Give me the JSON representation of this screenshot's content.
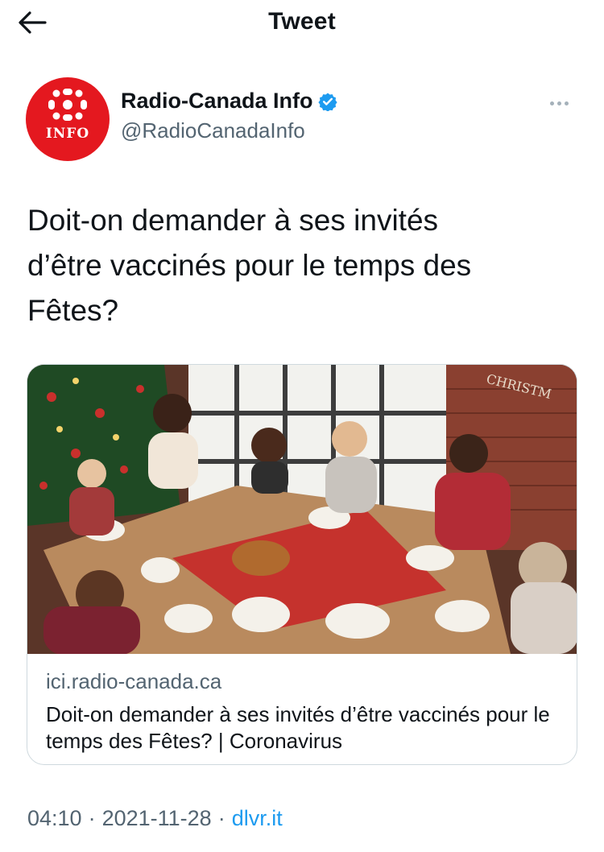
{
  "header": {
    "title": "Tweet",
    "back_icon": "arrow-left-icon"
  },
  "author": {
    "display_name": "Radio-Canada Info",
    "handle": "@RadioCanadaInfo",
    "verified": true,
    "avatar_label": "INFO",
    "brand_color": "#e4181f",
    "verified_color": "#1d9bf0"
  },
  "tweet": {
    "text": "Doit-on demander à ses invités\nd’être vaccinés pour le temps des\nFêtes?"
  },
  "card": {
    "image_icon": "holiday-dinner-photo",
    "image_sign_text": "CHRISTM",
    "domain": "ici.radio-canada.ca",
    "title": "Doit-on demander à ses invités d’être vaccinés pour le temps des Fêtes? | Coronavirus"
  },
  "meta": {
    "time": "04:10",
    "date": "2021-11-28",
    "separator": "·",
    "source": "dlvr.it"
  }
}
